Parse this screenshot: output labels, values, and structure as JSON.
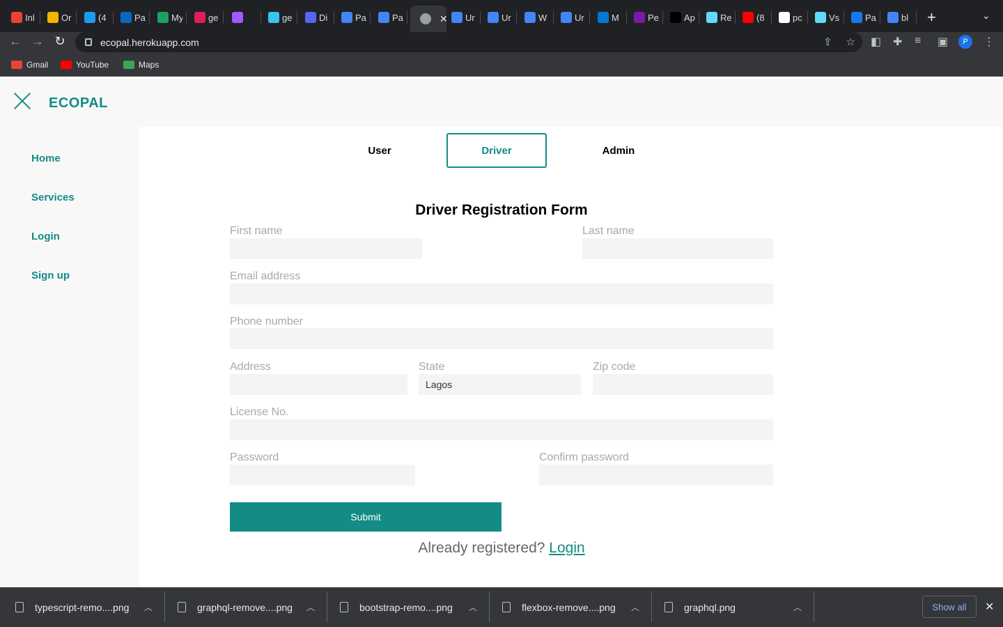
{
  "browser": {
    "tabs": [
      {
        "title": "Inl",
        "icon": "gmail-icon",
        "color": "#ea4335"
      },
      {
        "title": "Or",
        "icon": "pen-icon",
        "color": "#f4b400"
      },
      {
        "title": "(4",
        "icon": "twitter-icon",
        "color": "#1d9bf0"
      },
      {
        "title": "Pa",
        "icon": "linkedin-icon",
        "color": "#0a66c2"
      },
      {
        "title": "My",
        "icon": "app-icon",
        "color": "#1aa260"
      },
      {
        "title": "ge",
        "icon": "slack-icon",
        "color": "#e01e5a"
      },
      {
        "title": "",
        "icon": "figma-icon",
        "color": "#a259ff"
      },
      {
        "title": "ge",
        "icon": "slack-icon",
        "color": "#36c5f0"
      },
      {
        "title": "Di",
        "icon": "discord-icon",
        "color": "#5865f2"
      },
      {
        "title": "Pa",
        "icon": "docs-icon",
        "color": "#4285f4"
      },
      {
        "title": "Pa",
        "icon": "docs-icon",
        "color": "#4285f4"
      },
      {
        "title": "Ur",
        "icon": "docs-icon",
        "color": "#4285f4"
      },
      {
        "title": "Ur",
        "icon": "docs-icon",
        "color": "#4285f4"
      },
      {
        "title": "W",
        "icon": "docs-icon",
        "color": "#4285f4"
      },
      {
        "title": "Ur",
        "icon": "docs-icon",
        "color": "#4285f4"
      },
      {
        "title": "M",
        "icon": "azure-icon",
        "color": "#0078d4"
      },
      {
        "title": "Pe",
        "icon": "onenote-icon",
        "color": "#7719aa"
      },
      {
        "title": "Ap",
        "icon": "zeplin-icon",
        "color": "#000000"
      },
      {
        "title": "Re",
        "icon": "react-icon",
        "color": "#61dafb"
      },
      {
        "title": "(8",
        "icon": "youtube-icon",
        "color": "#ff0000"
      },
      {
        "title": "pc",
        "icon": "github-icon",
        "color": "#ffffff"
      },
      {
        "title": "Vs",
        "icon": "react-icon",
        "color": "#61dafb"
      },
      {
        "title": "Pa",
        "icon": "facebook-icon",
        "color": "#1877f2"
      },
      {
        "title": "bl",
        "icon": "google-icon",
        "color": "#4285f4"
      }
    ],
    "active_tab_close": "✕",
    "new_tab": "+",
    "tab_menu": "⌄",
    "url": "ecopal.herokuapp.com",
    "profile_initial": "P",
    "bookmarks": [
      {
        "label": "Gmail",
        "color": "#ea4335"
      },
      {
        "label": "YouTube",
        "color": "#ff0000"
      },
      {
        "label": "Maps",
        "color": "#34a853"
      }
    ]
  },
  "app": {
    "brand": "ECOPAL",
    "nav": [
      "Home",
      "Services",
      "Login",
      "Sign up"
    ],
    "role_tabs": [
      "User",
      "Driver",
      "Admin"
    ],
    "active_role": "Driver",
    "form": {
      "title": "Driver Registration Form",
      "first_name": "First name",
      "last_name": "Last name",
      "email": "Email address",
      "phone": "Phone number",
      "address": "Address",
      "state": "State",
      "state_value": "Lagos",
      "zip": "Zip code",
      "license": "License No.",
      "password": "Password",
      "confirm_password": "Confirm password",
      "submit": "Submit",
      "already_text": "Already registered?",
      "login_link": "Login"
    },
    "accent_color": "#138b86"
  },
  "downloads": {
    "files": [
      "typescript-remo....png",
      "graphql-remove....png",
      "bootstrap-remo....png",
      "flexbox-remove....png",
      "graphql.png"
    ],
    "show_all": "Show all"
  }
}
